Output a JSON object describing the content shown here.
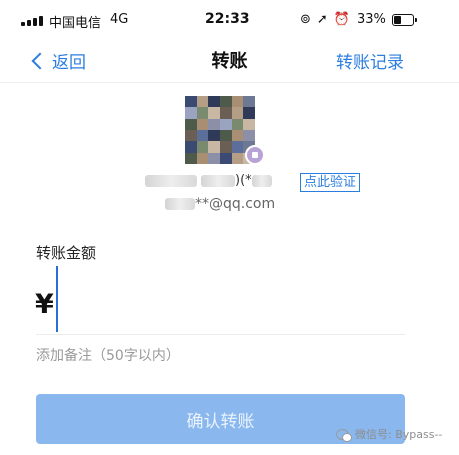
{
  "status_bar": {
    "carrier": "中国电信",
    "network": "4G",
    "time": "22:33",
    "battery_percent": "33%",
    "battery_level": 0.33,
    "icons": [
      "orientation-lock-icon",
      "location-arrow-icon",
      "alarm-icon"
    ]
  },
  "nav": {
    "back_label": "返回",
    "title": "转账",
    "records_label": "转账记录"
  },
  "recipient": {
    "name_fragment": ")(*",
    "verify_label": "点此验证",
    "email_suffix": "**@qq.com"
  },
  "amount": {
    "label": "转账金额",
    "currency_symbol": "¥",
    "value": ""
  },
  "note": {
    "placeholder": "添加备注（50字以内）"
  },
  "confirm": {
    "label": "确认转账"
  },
  "watermark": {
    "text": "微信号: Bypass--"
  },
  "colors": {
    "accent": "#2b7de0",
    "button_disabled": "#8ab8ee",
    "divider": "#ececec"
  }
}
